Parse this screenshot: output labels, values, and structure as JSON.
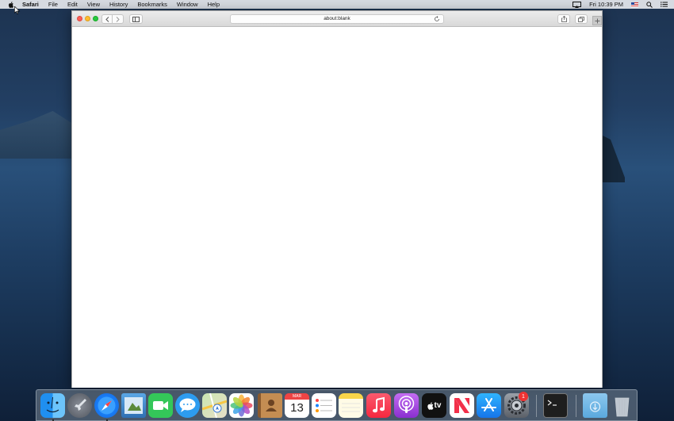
{
  "menubar": {
    "app_name": "Safari",
    "items": [
      "File",
      "Edit",
      "View",
      "History",
      "Bookmarks",
      "Window",
      "Help"
    ],
    "clock": "Fri 10:39 PM"
  },
  "browser": {
    "address": "about:blank"
  },
  "dock": {
    "calendar_month": "MAR",
    "calendar_day": "13",
    "tv_label": "tv",
    "app_store_badge": "1"
  },
  "colors": {
    "accent": "#1a84ff",
    "close": "#fc5f57",
    "minimize": "#fdbc2e",
    "maximize": "#27c840"
  }
}
